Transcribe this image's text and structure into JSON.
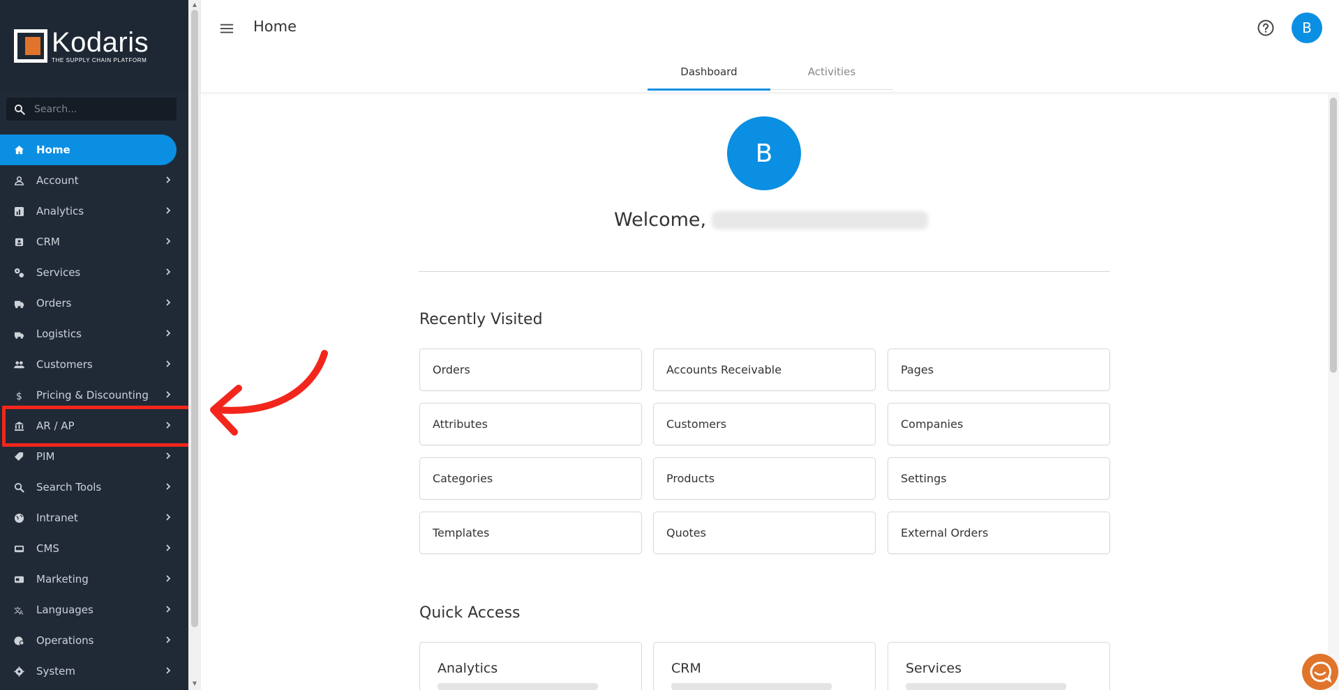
{
  "brand": {
    "name": "Kodaris",
    "tagline": "THE SUPPLY CHAIN PLATFORM",
    "accent": "#0b8fe2",
    "logo_orange": "#e0742b",
    "highlight": "#f2261c"
  },
  "sidebar": {
    "search_placeholder": "Search...",
    "items": [
      {
        "label": "Home",
        "icon": "home-icon"
      },
      {
        "label": "Account",
        "icon": "person-icon"
      },
      {
        "label": "Analytics",
        "icon": "chart-icon"
      },
      {
        "label": "CRM",
        "icon": "contact-card-icon"
      },
      {
        "label": "Services",
        "icon": "gears-icon"
      },
      {
        "label": "Orders",
        "icon": "truck-icon"
      },
      {
        "label": "Logistics",
        "icon": "delivery-icon"
      },
      {
        "label": "Customers",
        "icon": "people-icon"
      },
      {
        "label": "Pricing & Discounting",
        "icon": "dollar-icon"
      },
      {
        "label": "AR / AP",
        "icon": "bank-icon"
      },
      {
        "label": "PIM",
        "icon": "tag-icon"
      },
      {
        "label": "Search Tools",
        "icon": "search-icon"
      },
      {
        "label": "Intranet",
        "icon": "globe-icon"
      },
      {
        "label": "CMS",
        "icon": "screen-icon"
      },
      {
        "label": "Marketing",
        "icon": "megaphone-icon"
      },
      {
        "label": "Languages",
        "icon": "translate-icon"
      },
      {
        "label": "Operations",
        "icon": "operations-icon"
      },
      {
        "label": "System",
        "icon": "gear-icon"
      }
    ]
  },
  "header": {
    "title": "Home",
    "avatar_initial": "B",
    "tabs": [
      {
        "label": "Dashboard"
      },
      {
        "label": "Activities"
      }
    ]
  },
  "main": {
    "avatar_initial": "B",
    "welcome": "Welcome,",
    "recently_visited": {
      "title": "Recently Visited",
      "items": [
        "Orders",
        "Accounts Receivable",
        "Pages",
        "Attributes",
        "Customers",
        "Companies",
        "Categories",
        "Products",
        "Settings",
        "Templates",
        "Quotes",
        "External Orders"
      ]
    },
    "quick_access": {
      "title": "Quick Access",
      "items": [
        "Analytics",
        "CRM",
        "Services"
      ]
    }
  }
}
